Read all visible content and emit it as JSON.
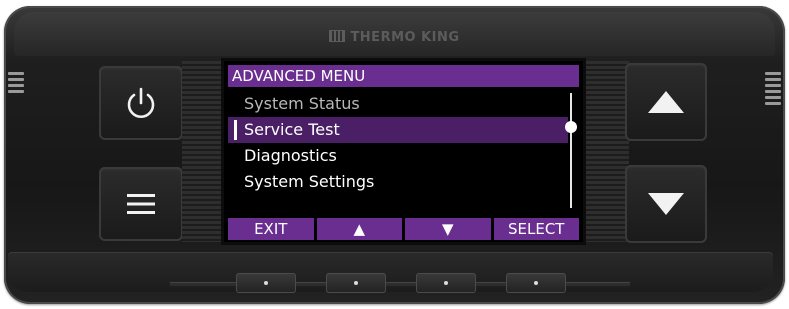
{
  "device": {
    "brand": "THERMO KING"
  },
  "screen": {
    "title": "ADVANCED MENU",
    "items": [
      {
        "label": "System Status",
        "state": "muted"
      },
      {
        "label": "Service Test",
        "state": "selected"
      },
      {
        "label": "Diagnostics",
        "state": "normal"
      },
      {
        "label": "System Settings",
        "state": "normal"
      }
    ],
    "softkeys": {
      "exit": "EXIT",
      "up": "▲",
      "down": "▼",
      "select": "SELECT"
    }
  },
  "colors": {
    "accent_purple": "#6a2e91",
    "selected_row": "#4a1f66",
    "screen_bg": "#000000",
    "bezel": "#1f1f1f"
  },
  "icons": {
    "power_button": "power-icon",
    "menu_button": "hamburger-menu-icon",
    "up_button": "triangle-up-icon",
    "down_button": "triangle-down-icon"
  }
}
